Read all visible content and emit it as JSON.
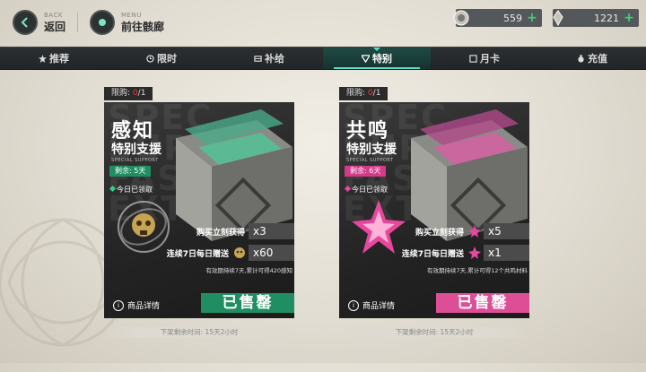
{
  "topbar": {
    "back": {
      "sub": "BACK",
      "label": "返回"
    },
    "menu": {
      "sub": "MENU",
      "label": "前往骸廊"
    },
    "currencies": [
      {
        "icon": "currency-coin-icon",
        "value": "559",
        "plus": "+"
      },
      {
        "icon": "currency-crystal-icon",
        "value": "1221",
        "plus": "+"
      }
    ]
  },
  "tabs": [
    {
      "label": "推荐",
      "icon": "star-icon",
      "active": false
    },
    {
      "label": "限时",
      "icon": "clock-icon",
      "active": false
    },
    {
      "label": "补给",
      "icon": "supply-icon",
      "active": false
    },
    {
      "label": "特别",
      "icon": "triangle-icon",
      "active": true
    },
    {
      "label": "月卡",
      "icon": "card-icon",
      "active": false
    },
    {
      "label": "充值",
      "icon": "bag-icon",
      "active": false
    }
  ],
  "cards": [
    {
      "limit_label": "限购:",
      "limit_current": "0",
      "limit_total": "/1",
      "title": "感知",
      "subtitle": "特别支援",
      "en_sub": "SPECIAL SUPPORT",
      "big_letters": "SPEC SUPP FAST EXT",
      "remain": "剩余: 5天",
      "claimed": "今日已领取",
      "buy_label": "购买立刻获得",
      "buy_qty": "x3",
      "daily_label": "连续7日每日赠送",
      "daily_qty": "x60",
      "note": "有效期持续7天,累计可得420感知",
      "details": "商品详情",
      "sold": "已售罄",
      "bottom": "下架剩余时间: 15天2小时",
      "accent": "#1f8e62"
    },
    {
      "limit_label": "限购:",
      "limit_current": "0",
      "limit_total": "/1",
      "title": "共鸣",
      "subtitle": "特别支援",
      "en_sub": "SPECIAL SUPPORT",
      "big_letters": "SPEC SUPP FAST EXT",
      "remain": "剩余: 6天",
      "claimed": "今日已领取",
      "buy_label": "购买立刻获得",
      "buy_qty": "x5",
      "daily_label": "连续7日每日赠送",
      "daily_qty": "x1",
      "note": "有效期持续7天,累计可得12个共鸣材料",
      "details": "商品详情",
      "sold": "已售罄",
      "bottom": "下架剩余时间: 15天2小时",
      "accent": "#de4e97"
    }
  ]
}
